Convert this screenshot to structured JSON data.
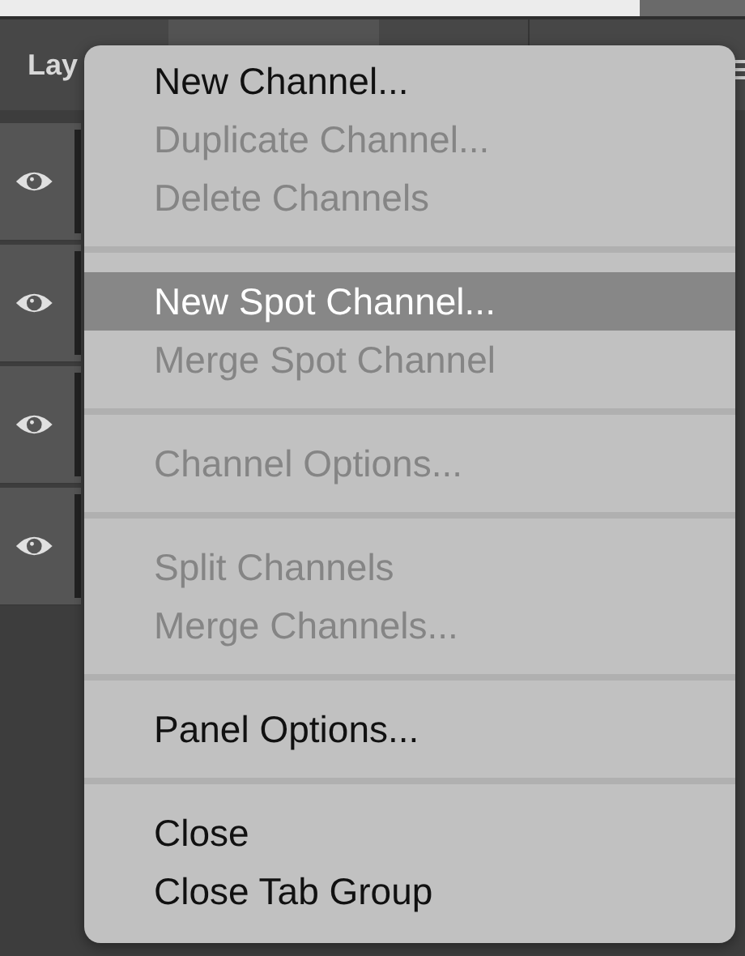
{
  "panel": {
    "tab": "Lay",
    "layers": [
      {
        "visible": true
      },
      {
        "visible": true
      },
      {
        "visible": true
      },
      {
        "visible": true
      }
    ]
  },
  "menu": {
    "groups": [
      {
        "items": [
          {
            "label": "New Channel...",
            "disabled": false,
            "selected": false
          },
          {
            "label": "Duplicate Channel...",
            "disabled": true,
            "selected": false
          },
          {
            "label": "Delete Channels",
            "disabled": true,
            "selected": false
          }
        ]
      },
      {
        "items": [
          {
            "label": "New Spot Channel...",
            "disabled": false,
            "selected": true
          },
          {
            "label": "Merge Spot Channel",
            "disabled": true,
            "selected": false
          }
        ]
      },
      {
        "items": [
          {
            "label": "Channel Options...",
            "disabled": true,
            "selected": false
          }
        ]
      },
      {
        "items": [
          {
            "label": "Split Channels",
            "disabled": true,
            "selected": false
          },
          {
            "label": "Merge Channels...",
            "disabled": true,
            "selected": false
          }
        ]
      },
      {
        "items": [
          {
            "label": "Panel Options...",
            "disabled": false,
            "selected": false
          }
        ]
      },
      {
        "items": [
          {
            "label": "Close",
            "disabled": false,
            "selected": false
          },
          {
            "label": "Close Tab Group",
            "disabled": false,
            "selected": false
          }
        ]
      }
    ]
  }
}
